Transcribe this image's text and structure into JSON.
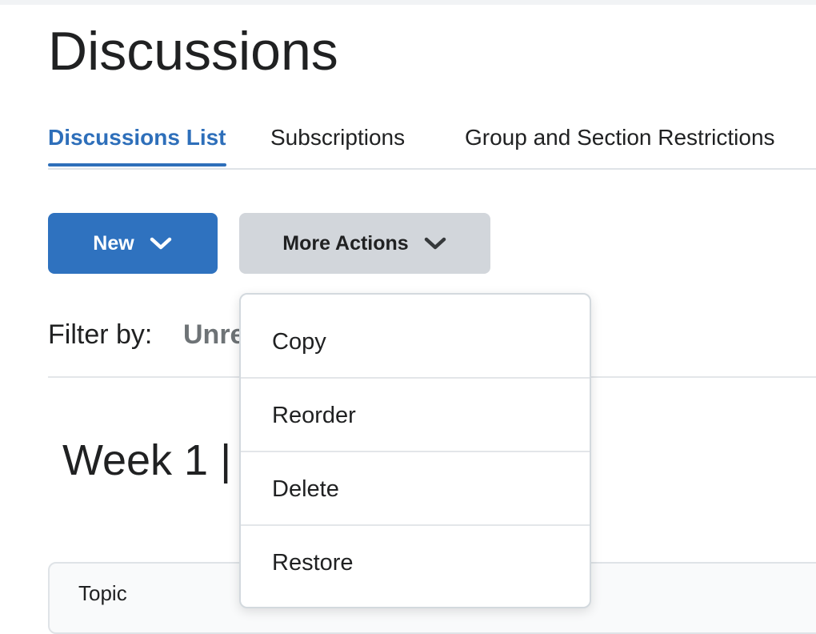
{
  "page": {
    "title": "Discussions"
  },
  "tabs": [
    {
      "label": "Discussions List",
      "active": true
    },
    {
      "label": "Subscriptions",
      "active": false
    },
    {
      "label": "Group and Section Restrictions",
      "active": false
    }
  ],
  "toolbar": {
    "new_label": "New",
    "more_actions_label": "More Actions"
  },
  "filter": {
    "label": "Filter by:",
    "value": "Unre"
  },
  "section": {
    "heading": "Week 1 |"
  },
  "table": {
    "columns": [
      "Topic"
    ]
  },
  "more_actions_menu": {
    "items": [
      "Copy",
      "Reorder",
      "Delete",
      "Restore"
    ]
  },
  "icons": {
    "dropdown": "chevron-down-icon"
  },
  "colors": {
    "primary": "#2f72bf",
    "active_tab": "#2e6fba",
    "secondary_button": "#d2d6db"
  }
}
